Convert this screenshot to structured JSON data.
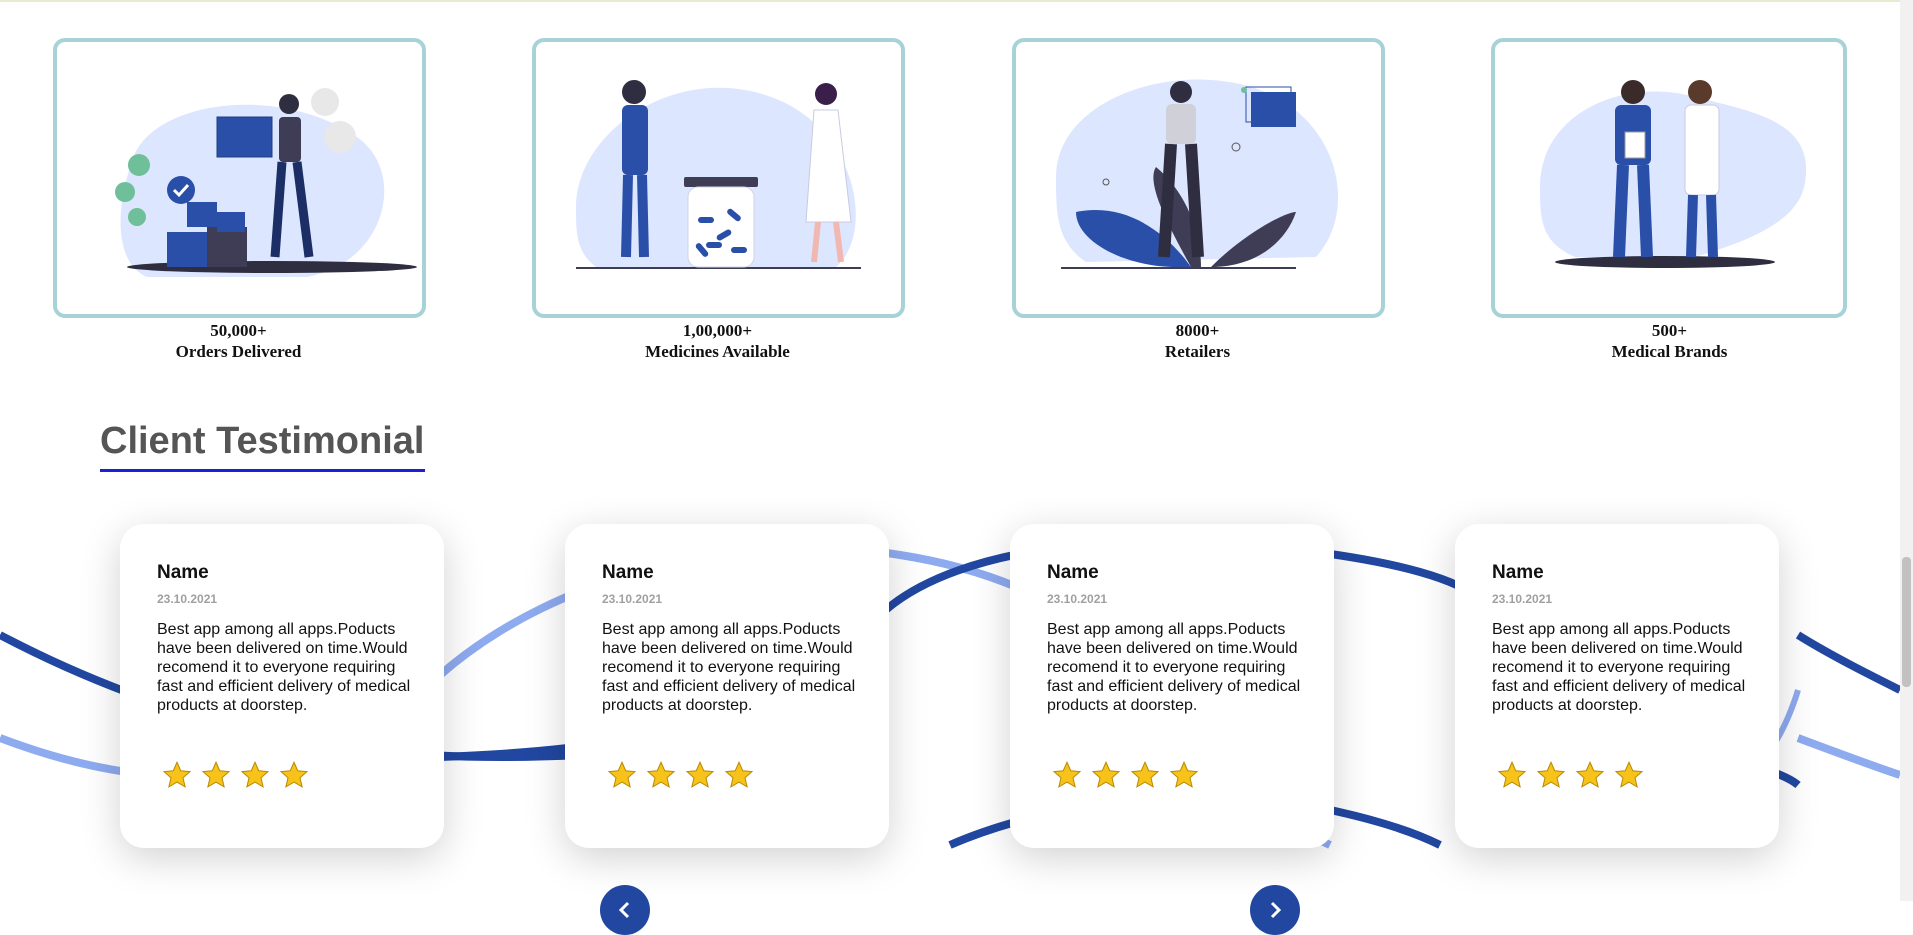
{
  "stats": [
    {
      "number": "50,000+",
      "label": "Orders Delivered"
    },
    {
      "number": "1,00,000+",
      "label": "Medicines Available"
    },
    {
      "number": "8000+",
      "label": "Retailers"
    },
    {
      "number": "500+",
      "label": "Medical Brands"
    }
  ],
  "testimonials": {
    "title": "Client Testimonial",
    "cards": [
      {
        "name": "Name",
        "date": "23.10.2021",
        "text": "Best app among all apps.Poducts have been delivered on time.Would recomend it to everyone requiring fast and efficient delivery of medical products at doorstep.",
        "rating": 4
      },
      {
        "name": "Name",
        "date": "23.10.2021",
        "text": "Best app among all apps.Poducts have been delivered on time.Would recomend it to everyone requiring fast and efficient delivery of medical products at doorstep.",
        "rating": 4
      },
      {
        "name": "Name",
        "date": "23.10.2021",
        "text": "Best app among all apps.Poducts have been delivered on time.Would recomend it to everyone requiring fast and efficient delivery of medical products at doorstep.",
        "rating": 4
      },
      {
        "name": "Name",
        "date": "23.10.2021",
        "text": "Best app among all apps.Poducts have been delivered on time.Would recomend it to everyone requiring fast and efficient delivery of medical products at doorstep.",
        "rating": 4
      }
    ]
  },
  "icons": {
    "star": "star-icon",
    "prev": "chevron-left-icon",
    "next": "chevron-right-icon"
  },
  "colors": {
    "accent": "#2147a0",
    "card_border": "#a7d3d8",
    "underline": "#1d1fd6",
    "star": "#f7c21a",
    "blob": "#dde6ff"
  }
}
